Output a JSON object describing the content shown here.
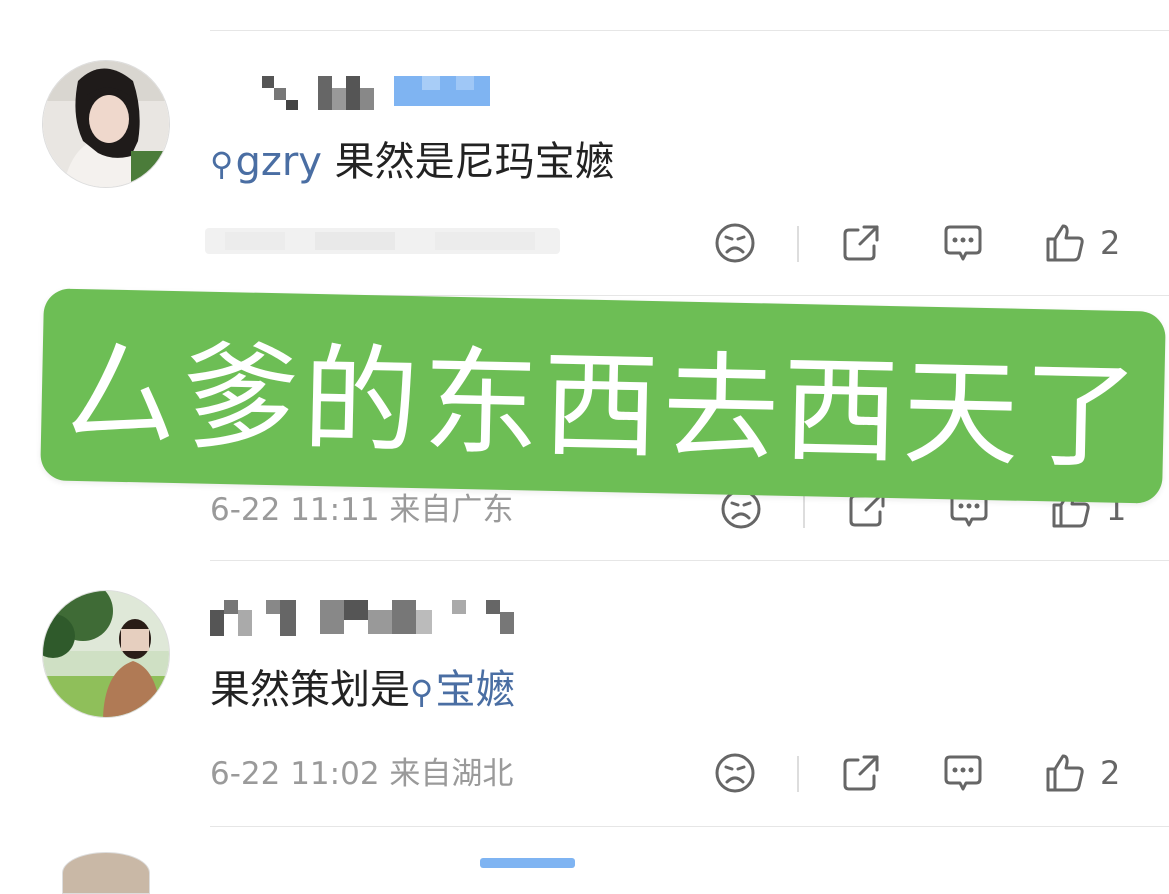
{
  "comments": [
    {
      "text_link": "gzry",
      "text": " 果然是尼玛宝嬷",
      "meta": "",
      "like_count": "2"
    },
    {
      "meta": "6-22 11:11 来自广东",
      "like_count": "1"
    },
    {
      "text_prefix": "果然策划是",
      "text_link": "宝嬷",
      "meta": "6-22 11:02 来自湖北",
      "like_count": "2"
    }
  ],
  "overlay_banner": {
    "text": "厶爹的东西去西天了",
    "background": "#6dbe55",
    "text_color": "#ffffff"
  },
  "colors": {
    "link": "#4a6ea3",
    "meta": "#9a9a9a",
    "icon": "#666666",
    "divider": "#e6e6e6"
  },
  "icons": [
    "search-icon",
    "dislike-face-icon",
    "share-icon",
    "comment-icon",
    "like-thumb-icon"
  ]
}
